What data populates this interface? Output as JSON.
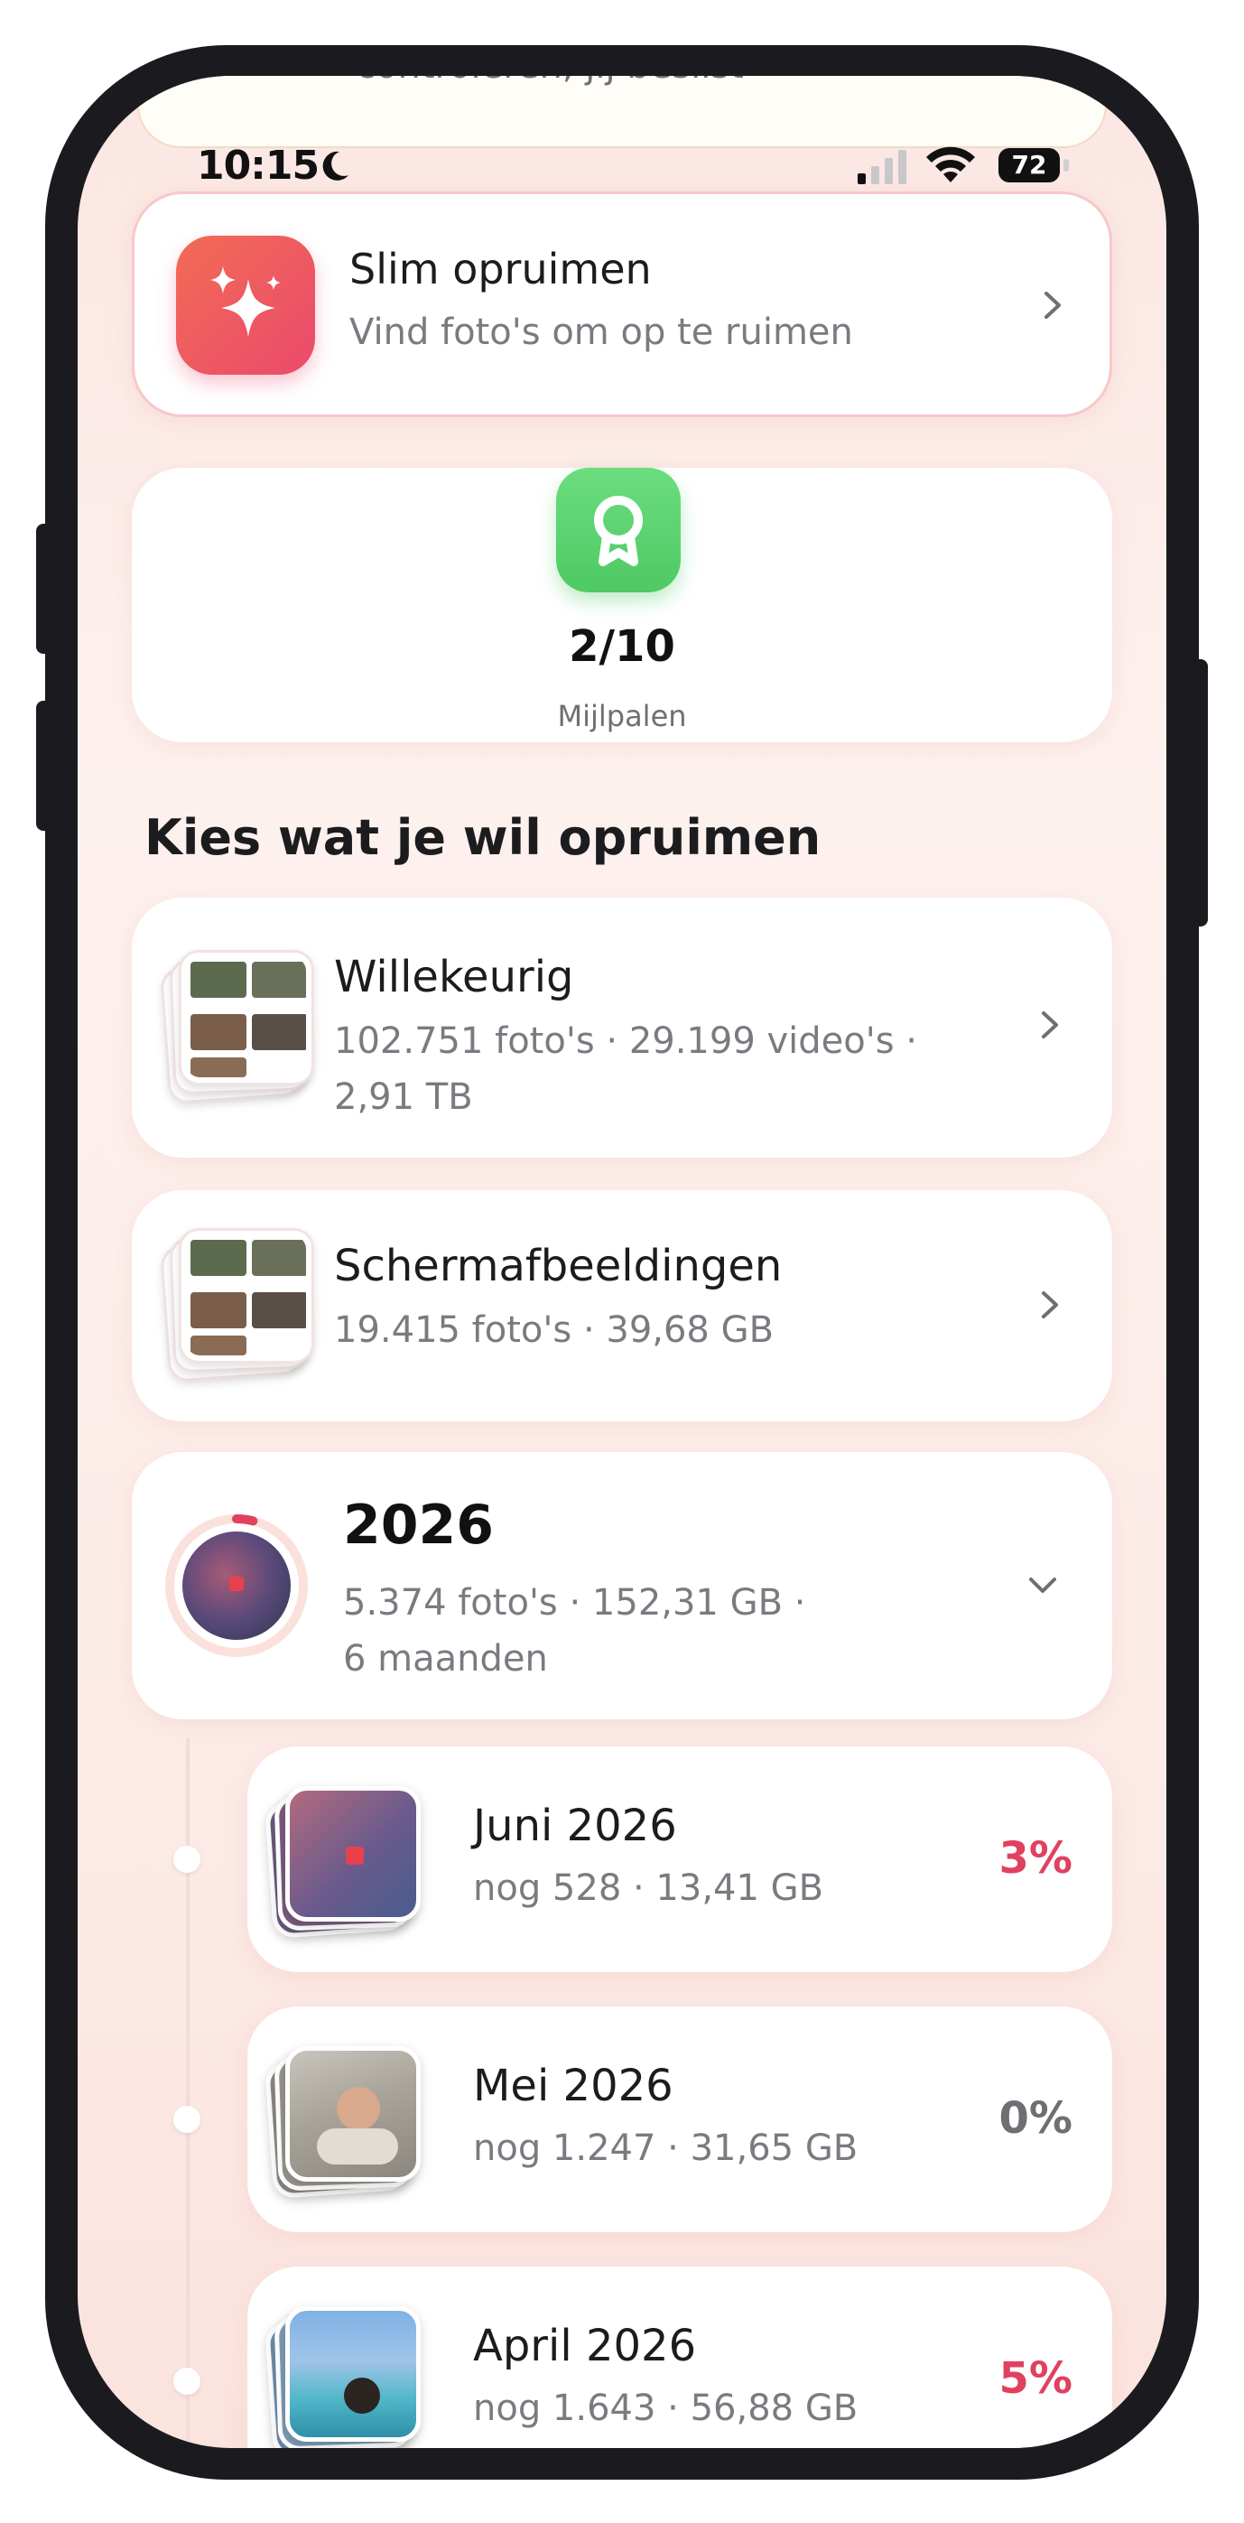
{
  "status_bar": {
    "time": "10:15",
    "battery": "72"
  },
  "peek_text": "controleren, jij beslist",
  "smart_cleanup": {
    "title": "Slim opruimen",
    "subtitle": "Vind foto's om op te ruimen"
  },
  "milestones": {
    "count": "2/10",
    "label": "Mijlpalen"
  },
  "section_title": "Kies wat je wil opruimen",
  "albums": [
    {
      "title": "Willekeurig",
      "line1": "102.751 foto's · 29.199 video's ·",
      "line2": "2,91 TB"
    },
    {
      "title": "Schermafbeeldingen",
      "line1": "19.415 foto's · 39,68 GB"
    }
  ],
  "year": {
    "title": "2026",
    "line1": "5.374 foto's · 152,31 GB ·",
    "line2": "6 maanden",
    "progress": 0.04
  },
  "months": [
    {
      "title": "Juni 2026",
      "subtitle": "nog 528 · 13,41 GB",
      "percent": "3%",
      "color": "#e0415e"
    },
    {
      "title": "Mei 2026",
      "subtitle": "nog 1.247 · 31,65 GB",
      "percent": "0%",
      "color": "#6e6e73"
    },
    {
      "title": "April 2026",
      "subtitle": "nog 1.643 · 56,88 GB",
      "percent": "5%",
      "color": "#e0415e"
    }
  ],
  "colors": {
    "accent": "#ea4a6c",
    "milestone_green": "#4ec963"
  }
}
